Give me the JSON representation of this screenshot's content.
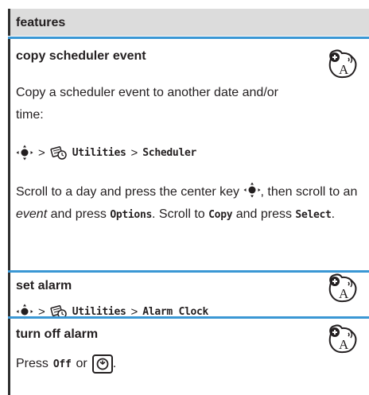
{
  "header": {
    "title": "features"
  },
  "sections": [
    {
      "title": "copy scheduler event",
      "description": "Copy a scheduler event to another date and/or time:",
      "path": [
        "Utilities",
        "Scheduler"
      ],
      "instruction": {
        "p1": "Scroll to a day and press the center key",
        "p2": ", then scroll to an",
        "event": "event",
        "p3": "and press",
        "options": "Options",
        "p4": ". Scroll to",
        "copy": "Copy",
        "p5": "and press",
        "select": "Select",
        "p6": "."
      }
    },
    {
      "title": "set alarm",
      "path": [
        "Utilities",
        "Alarm Clock"
      ]
    },
    {
      "title": "turn off alarm",
      "instruction": {
        "p1": "Press",
        "off": "Off",
        "p2": "or",
        "p3": "."
      }
    }
  ],
  "symbols": {
    "gt": ">"
  },
  "icons": {
    "network": "network-dependent-feature-icon",
    "nav_key": "navigation-key-icon",
    "utilities": "utilities-icon",
    "smart_key": "smart-key-icon"
  },
  "colors": {
    "rule": "#3a97d4",
    "header_bg": "#dcdcdc",
    "text": "#231f20"
  }
}
